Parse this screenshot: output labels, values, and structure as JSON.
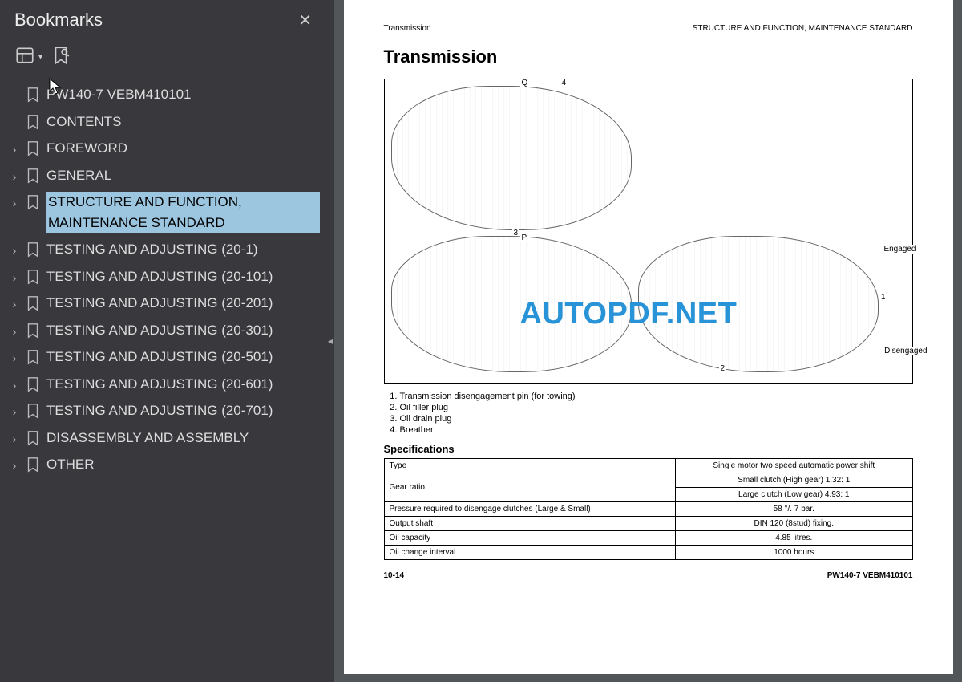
{
  "sidebar": {
    "title": "Bookmarks",
    "items": [
      {
        "label": "PW140-7    VEBM410101",
        "hasChildren": false
      },
      {
        "label": "CONTENTS",
        "hasChildren": false
      },
      {
        "label": "FOREWORD",
        "hasChildren": true
      },
      {
        "label": "GENERAL",
        "hasChildren": true
      },
      {
        "label": "STRUCTURE AND FUNCTION, MAINTENANCE STANDARD",
        "hasChildren": true,
        "selected": true
      },
      {
        "label": "TESTING AND ADJUSTING (20-1)",
        "hasChildren": true
      },
      {
        "label": "TESTING AND ADJUSTING (20-101)",
        "hasChildren": true
      },
      {
        "label": "TESTING AND ADJUSTING (20-201)",
        "hasChildren": true
      },
      {
        "label": "TESTING AND ADJUSTING (20-301)",
        "hasChildren": true
      },
      {
        "label": "TESTING AND ADJUSTING (20-501)",
        "hasChildren": true
      },
      {
        "label": "TESTING AND ADJUSTING (20-601)",
        "hasChildren": true
      },
      {
        "label": "TESTING AND ADJUSTING (20-701)",
        "hasChildren": true
      },
      {
        "label": "DISASSEMBLY AND ASSEMBLY",
        "hasChildren": true
      },
      {
        "label": "OTHER",
        "hasChildren": true
      }
    ]
  },
  "document": {
    "header_left": "Transmission",
    "header_right": "STRUCTURE AND FUNCTION, MAINTENANCE STANDARD",
    "title": "Transmission",
    "diagram_labels": {
      "q": "Q",
      "four": "4",
      "three": "3",
      "p": "P",
      "engaged": "Engaged",
      "disengaged": "Disengaged",
      "one": "1",
      "two": "2"
    },
    "legend": [
      "Transmission disengagement pin (for towing)",
      "Oil filler plug",
      "Oil drain plug",
      "Breather"
    ],
    "spec_title": "Specifications",
    "specs": {
      "type_label": "Type",
      "type_value": "Single motor two speed automatic power shift",
      "gear_label": "Gear ratio",
      "gear_small": "Small clutch (High gear) 1.32: 1",
      "gear_large": "Large clutch (Low gear) 4.93: 1",
      "pressure_label": "Pressure required to disengage clutches (Large & Small)",
      "pressure_value": "58 °/. 7 bar.",
      "output_label": "Output shaft",
      "output_value": "DIN 120 (8stud) fixing.",
      "capacity_label": "Oil capacity",
      "capacity_value": "4.85 litres.",
      "interval_label": "Oil change interval",
      "interval_value": "1000 hours"
    },
    "footer_left": "10-14",
    "footer_right": "PW140-7   VEBM410101"
  },
  "watermark": "AUTOPDF.NET"
}
